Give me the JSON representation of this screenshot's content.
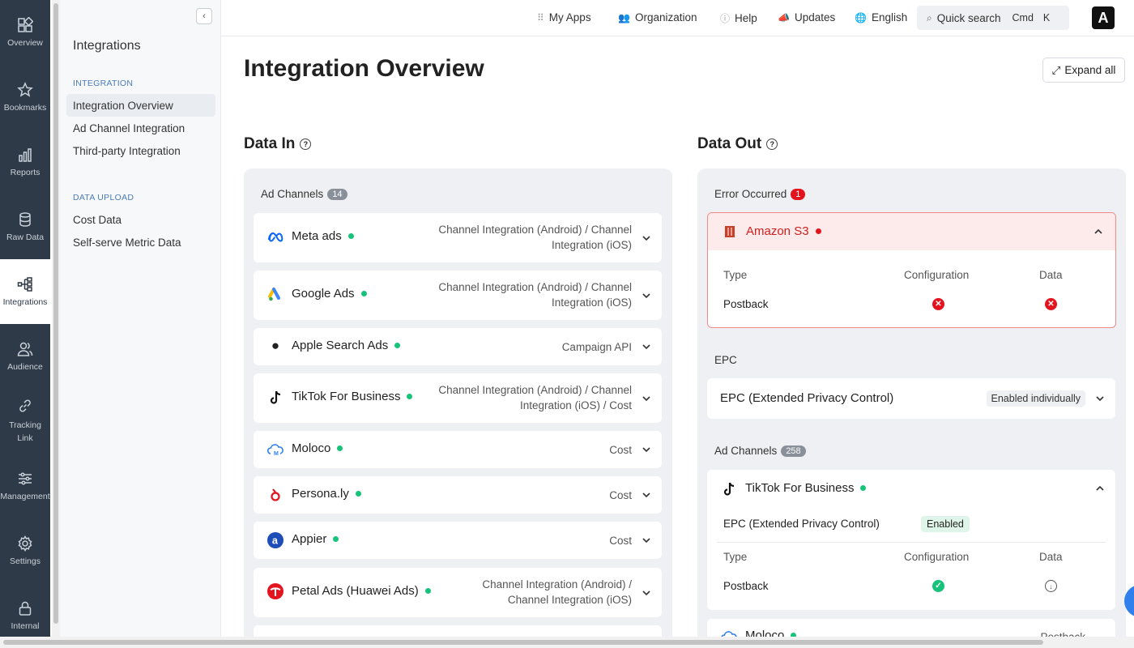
{
  "rail": [
    {
      "label": "Overview",
      "icon": "overview-icon"
    },
    {
      "label": "Bookmarks",
      "icon": "star-icon"
    },
    {
      "label": "Reports",
      "icon": "bar-chart-icon"
    },
    {
      "label": "Raw Data",
      "icon": "database-icon"
    },
    {
      "label": "Integrations",
      "icon": "integrations-icon",
      "active": true
    },
    {
      "label": "Audience",
      "icon": "users-icon"
    },
    {
      "label": "Tracking\nLink",
      "icon": "link-icon"
    },
    {
      "label": "Management",
      "icon": "sliders-icon"
    },
    {
      "label": "Settings",
      "icon": "gear-icon"
    },
    {
      "label": "Internal",
      "icon": "lock-icon"
    }
  ],
  "subnav": {
    "title": "Integrations",
    "sections": [
      {
        "label": "INTEGRATION",
        "items": [
          "Integration Overview",
          "Ad Channel Integration",
          "Third-party Integration"
        ]
      },
      {
        "label": "DATA UPLOAD",
        "items": [
          "Cost Data",
          "Self-serve Metric Data"
        ]
      }
    ]
  },
  "topbar": {
    "my_apps": "My Apps",
    "organization": "Organization",
    "help": "Help",
    "updates": "Updates",
    "language": "English",
    "quick_search": "Quick search",
    "kbd_cmd": "Cmd",
    "kbd_k": "K",
    "logo_letter": "A"
  },
  "main": {
    "title": "Integration Overview",
    "expand_all": "Expand all"
  },
  "data_in": {
    "title": "Data In",
    "ad_channels_label": "Ad Channels",
    "ad_channels_count": "14",
    "channels": [
      {
        "name": "Meta ads",
        "types": [
          "Channel Integration (Android) / Channel",
          "Integration (iOS)"
        ]
      },
      {
        "name": "Google Ads",
        "types": [
          "Channel Integration (Android) / Channel",
          "Integration (iOS)"
        ]
      },
      {
        "name": "Apple Search Ads",
        "types": [
          "Campaign API"
        ]
      },
      {
        "name": "TikTok For Business",
        "types": [
          "Channel Integration (Android) / Channel",
          "Integration (iOS) / Cost"
        ]
      },
      {
        "name": "Moloco",
        "types": [
          "Cost"
        ]
      },
      {
        "name": "Persona.ly",
        "types": [
          "Cost"
        ]
      },
      {
        "name": "Appier",
        "types": [
          "Cost"
        ]
      },
      {
        "name": "Petal Ads (Huawei Ads)",
        "types": [
          "Channel Integration (Android) /",
          "Channel Integration (iOS)"
        ]
      }
    ]
  },
  "data_out": {
    "title": "Data Out",
    "error_label": "Error Occurred",
    "error_count": "1",
    "error_card": {
      "name": "Amazon S3",
      "col_type": "Type",
      "col_config": "Configuration",
      "col_data": "Data",
      "row_type": "Postback"
    },
    "epc_label": "EPC",
    "epc_card": {
      "name": "EPC (Extended Privacy Control)",
      "badge": "Enabled individually"
    },
    "ad_channels_label": "Ad Channels",
    "ad_channels_count": "258",
    "tiktok_card": {
      "name": "TikTok For Business",
      "epc_label": "EPC (Extended Privacy Control)",
      "epc_badge": "Enabled",
      "col_type": "Type",
      "col_config": "Configuration",
      "col_data": "Data",
      "row_type": "Postback"
    },
    "partial_card": {
      "name": "Moloco",
      "types": "Postback"
    }
  },
  "colors": {
    "rail_bg": "#2e3a47",
    "success": "#17c37b",
    "error": "#e4141e",
    "panel_bg": "#eef0f3"
  }
}
